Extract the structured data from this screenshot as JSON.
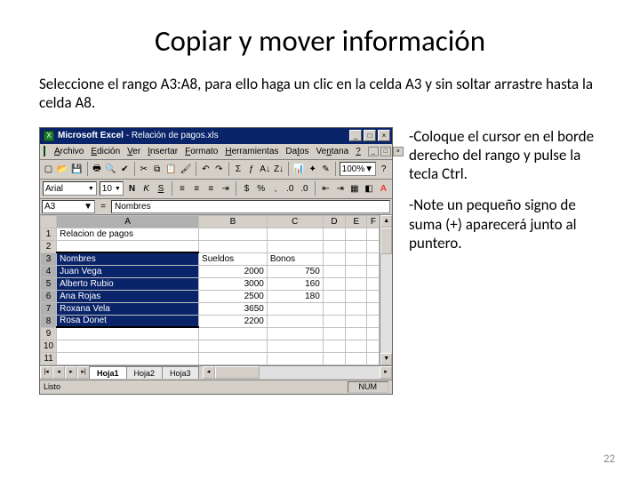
{
  "title": "Copiar y mover información",
  "intro": "Seleccione el rango A3:A8, para ello haga un clic en la celda A3 y sin soltar arrastre hasta la celda A8.",
  "bullets": [
    "-Coloque el cursor en el borde derecho del rango y pulse la tecla Ctrl.",
    "-Note un pequeño signo de suma (+) aparecerá junto al puntero."
  ],
  "page_number": "22",
  "excel": {
    "app_name": "Microsoft Excel",
    "doc_name": "Relación de pagos.xls",
    "menu": [
      "Archivo",
      "Edición",
      "Ver",
      "Insertar",
      "Formato",
      "Herramientas",
      "Datos",
      "Ventana",
      "?"
    ],
    "zoom": "100%",
    "font": "Arial",
    "font_size": "10",
    "namebox": "A3",
    "formula_value": "Nombres",
    "columns": [
      "A",
      "B",
      "C",
      "D",
      "E",
      "F"
    ],
    "rows": [
      {
        "n": "1",
        "A": "Relacion de pagos",
        "B": "",
        "C": "",
        "D": "",
        "E": ""
      },
      {
        "n": "2",
        "A": "",
        "B": "",
        "C": "",
        "D": "",
        "E": ""
      },
      {
        "n": "3",
        "A": "Nombres",
        "B": "Sueldos",
        "C": "Bonos",
        "D": "",
        "E": "",
        "sel": true,
        "first": true
      },
      {
        "n": "4",
        "A": "Juan Vega",
        "B": "2000",
        "C": "750",
        "D": "",
        "E": "",
        "sel": true
      },
      {
        "n": "5",
        "A": "Alberto Rubio",
        "B": "3000",
        "C": "160",
        "D": "",
        "E": "",
        "sel": true
      },
      {
        "n": "6",
        "A": "Ana Rojas",
        "B": "2500",
        "C": "180",
        "D": "",
        "E": "",
        "sel": true
      },
      {
        "n": "7",
        "A": "Roxana Vela",
        "B": "3650",
        "C": "",
        "D": "",
        "E": "",
        "sel": true
      },
      {
        "n": "8",
        "A": "Rosa Donet",
        "B": "2200",
        "C": "",
        "D": "",
        "E": "",
        "sel": true,
        "last": true
      },
      {
        "n": "9",
        "A": "",
        "B": "",
        "C": "",
        "D": "",
        "E": ""
      },
      {
        "n": "10",
        "A": "",
        "B": "",
        "C": "",
        "D": "",
        "E": ""
      },
      {
        "n": "11",
        "A": "",
        "B": "",
        "C": "",
        "D": "",
        "E": ""
      }
    ],
    "tabs": [
      "Hoja1",
      "Hoja2",
      "Hoja3"
    ],
    "active_tab": 0,
    "status": "Listo",
    "status_indicator": "NUM"
  }
}
